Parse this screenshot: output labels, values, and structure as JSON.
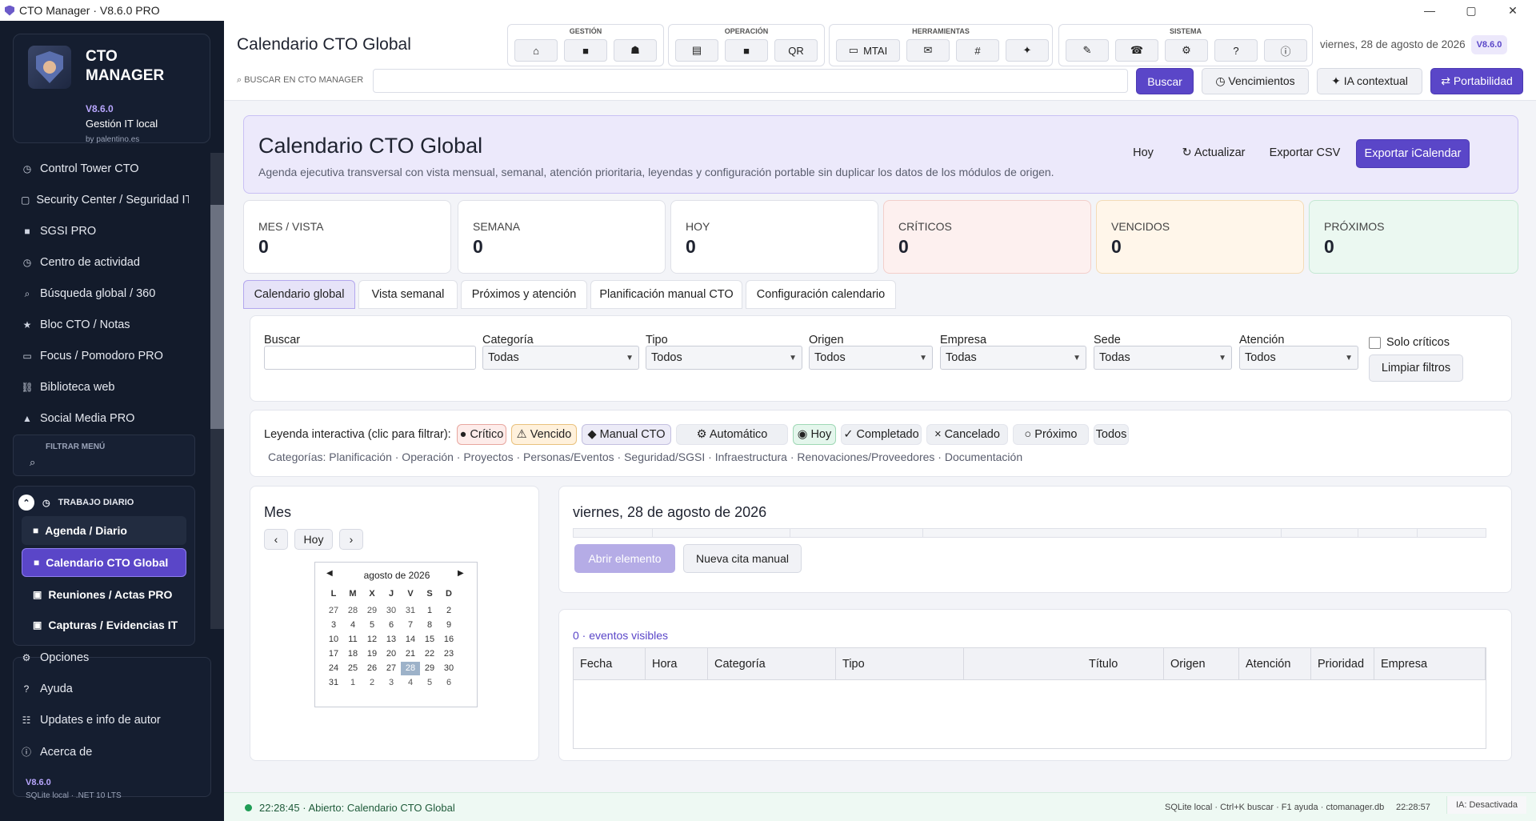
{
  "window": {
    "title": "CTO Manager · V8.6.0 PRO",
    "min": "—",
    "max": "▢",
    "close": "✕"
  },
  "brand": {
    "title": "CTO MANAGER",
    "version": "V8.6.0",
    "subtitle": "Gestión IT local",
    "by": "by palentino.es"
  },
  "nav": [
    {
      "icon": "◷",
      "label": "Control Tower CTO"
    },
    {
      "icon": "▢",
      "label": "Security Center / Seguridad IT"
    },
    {
      "icon": "■",
      "label": "SGSI PRO"
    },
    {
      "icon": "◷",
      "label": "Centro de actividad"
    },
    {
      "icon": "⌕",
      "label": "Búsqueda global / 360"
    },
    {
      "icon": "★",
      "label": "Bloc CTO / Notas"
    },
    {
      "icon": "▭",
      "label": "Focus / Pomodoro PRO"
    },
    {
      "icon": "⛓",
      "label": "Biblioteca web"
    },
    {
      "icon": "▲",
      "label": "Social Media PRO"
    }
  ],
  "filter_menu": {
    "label": "FILTRAR MENÚ",
    "icon": "⌕"
  },
  "group": {
    "title": "TRABAJO DIARIO",
    "items": [
      {
        "icon": "■",
        "label": "Agenda / Diario"
      },
      {
        "icon": "■",
        "label": "Calendario CTO Global"
      },
      {
        "icon": "▣",
        "label": "Reuniones / Actas PRO"
      },
      {
        "icon": "▣",
        "label": "Capturas / Evidencias IT"
      }
    ]
  },
  "bottom_nav": [
    {
      "icon": "⚙",
      "label": "Opciones"
    },
    {
      "icon": "?",
      "label": "Ayuda"
    },
    {
      "icon": "☷",
      "label": "Updates e info de autor"
    },
    {
      "icon": "ⓘ",
      "label": "Acerca de"
    }
  ],
  "footer": {
    "version": "V8.6.0",
    "runtime": "SQLite local · .NET 10 LTS"
  },
  "header": {
    "title": "Calendario CTO Global",
    "groups": {
      "gestion": "GESTIÓN",
      "operacion": "OPERACIÓN",
      "herramientas": "HERRAMIENTAS",
      "sistema": "SISTEMA"
    },
    "tool_buttons": {
      "home": "⌂",
      "grid": "■",
      "cap": "☗",
      "doc": "▤",
      "box": "■",
      "qr": "QR",
      "mtai": "MTAI",
      "mail": "✉",
      "hash": "#",
      "star": "✦",
      "pen": "✎",
      "phone": "☎",
      "gear": "⚙",
      "help": "?",
      "info": "ⓘ"
    },
    "date": "viernes, 28 de agosto de 2026",
    "version": "V8.6.0",
    "search_label": "⌕  BUSCAR EN CTO MANAGER",
    "search_value": "",
    "buttons": {
      "buscar": "Buscar",
      "vencimientos": "◷  Vencimientos",
      "ia": "✦  IA contextual",
      "portabilidad": "⇄ Portabilidad"
    }
  },
  "hero": {
    "title": "Calendario CTO Global",
    "desc": "Agenda ejecutiva transversal con vista mensual, semanal, atención prioritaria, leyendas y configuración portable sin duplicar los datos de los módulos de origen.",
    "buttons": {
      "hoy": "Hoy",
      "actualizar": "↻ Actualizar",
      "csv": "Exportar CSV",
      "ical": "Exportar iCalendar"
    }
  },
  "stats": [
    {
      "label": "MES / VISTA",
      "value": "0",
      "bg": "#ffffff",
      "border": "#dfe1e8"
    },
    {
      "label": "SEMANA",
      "value": "0",
      "bg": "#ffffff",
      "border": "#dfe1e8"
    },
    {
      "label": "HOY",
      "value": "0",
      "bg": "#ffffff",
      "border": "#dfe1e8"
    },
    {
      "label": "CRÍTICOS",
      "value": "0",
      "bg": "#fdf0ef",
      "border": "#f3cfcb"
    },
    {
      "label": "VENCIDOS",
      "value": "0",
      "bg": "#fff6ea",
      "border": "#f4dcb7"
    },
    {
      "label": "PRÓXIMOS",
      "value": "0",
      "bg": "#ebf8f1",
      "border": "#c4e8d3"
    }
  ],
  "tabs": [
    "Calendario global",
    "Vista semanal",
    "Próximos y atención",
    "Planificación manual CTO",
    "Configuración calendario"
  ],
  "filters": {
    "buscar": {
      "label": "Buscar",
      "value": ""
    },
    "categoria": {
      "label": "Categoría",
      "value": "Todas"
    },
    "tipo": {
      "label": "Tipo",
      "value": "Todos"
    },
    "origen": {
      "label": "Origen",
      "value": "Todos"
    },
    "empresa": {
      "label": "Empresa",
      "value": "Todas"
    },
    "sede": {
      "label": "Sede",
      "value": "Todas"
    },
    "atencion": {
      "label": "Atención",
      "value": "Todos"
    },
    "solo_criticos": "Solo críticos",
    "limpiar": "Limpiar filtros"
  },
  "legend": {
    "label": "Leyenda interactiva (clic para filtrar):",
    "chips": [
      {
        "text": "● Crítico",
        "bg": "#fdecea",
        "border": "#e8a79f"
      },
      {
        "text": "⚠ Vencido",
        "bg": "#fff1dc",
        "border": "#e9c17d"
      },
      {
        "text": "◆ Manual CTO",
        "bg": "#ecebf7",
        "border": "#c3c0e0"
      },
      {
        "text": "⚙ Automático",
        "bg": "#eef0f4",
        "border": "#e3e5ec"
      },
      {
        "text": "◉ Hoy",
        "bg": "#e4f6ec",
        "border": "#9fd8b5"
      },
      {
        "text": "✓ Completado",
        "bg": "#eef0f4",
        "border": "#e3e5ec"
      },
      {
        "text": "× Cancelado",
        "bg": "#eef0f4",
        "border": "#e3e5ec"
      },
      {
        "text": "○ Próximo",
        "bg": "#eef0f4",
        "border": "#e3e5ec"
      },
      {
        "text": "Todos",
        "bg": "#eef0f4",
        "border": "#e3e5ec"
      }
    ],
    "categories": "Categorías: Planificación · Operación · Proyectos · Personas/Eventos · Seguridad/SGSI · Infraestructura · Renovaciones/Proveedores · Documentación"
  },
  "month": {
    "title": "Mes",
    "prev": "‹",
    "today": "Hoy",
    "next": "›",
    "cal_title": "agosto de 2026",
    "cal_prev": "◀",
    "cal_next": "▶",
    "weekdays": [
      "L",
      "M",
      "X",
      "J",
      "V",
      "S",
      "D"
    ],
    "weeks": [
      [
        "27",
        "28",
        "29",
        "30",
        "31",
        "1",
        "2"
      ],
      [
        "3",
        "4",
        "5",
        "6",
        "7",
        "8",
        "9"
      ],
      [
        "10",
        "11",
        "12",
        "13",
        "14",
        "15",
        "16"
      ],
      [
        "17",
        "18",
        "19",
        "20",
        "21",
        "22",
        "23"
      ],
      [
        "24",
        "25",
        "26",
        "27",
        "28",
        "29",
        "30"
      ],
      [
        "31",
        "1",
        "2",
        "3",
        "4",
        "5",
        "6"
      ]
    ]
  },
  "day": {
    "title": "viernes, 28 de agosto de 2026",
    "abrir": "Abrir elemento",
    "nueva": "Nueva cita manual"
  },
  "events": {
    "count": "0 · eventos visibles",
    "columns": [
      "Fecha",
      "Hora",
      "Categoría",
      "Tipo",
      "Título",
      "Origen",
      "Atención",
      "Prioridad",
      "Empresa"
    ]
  },
  "status": {
    "left": "22:28:45 · Abierto: Calendario CTO Global",
    "right": "SQLite local · Ctrl+K buscar · F1 ayuda · ctomanager.db",
    "time": "22:28:57",
    "ia": "IA: Desactivada"
  }
}
